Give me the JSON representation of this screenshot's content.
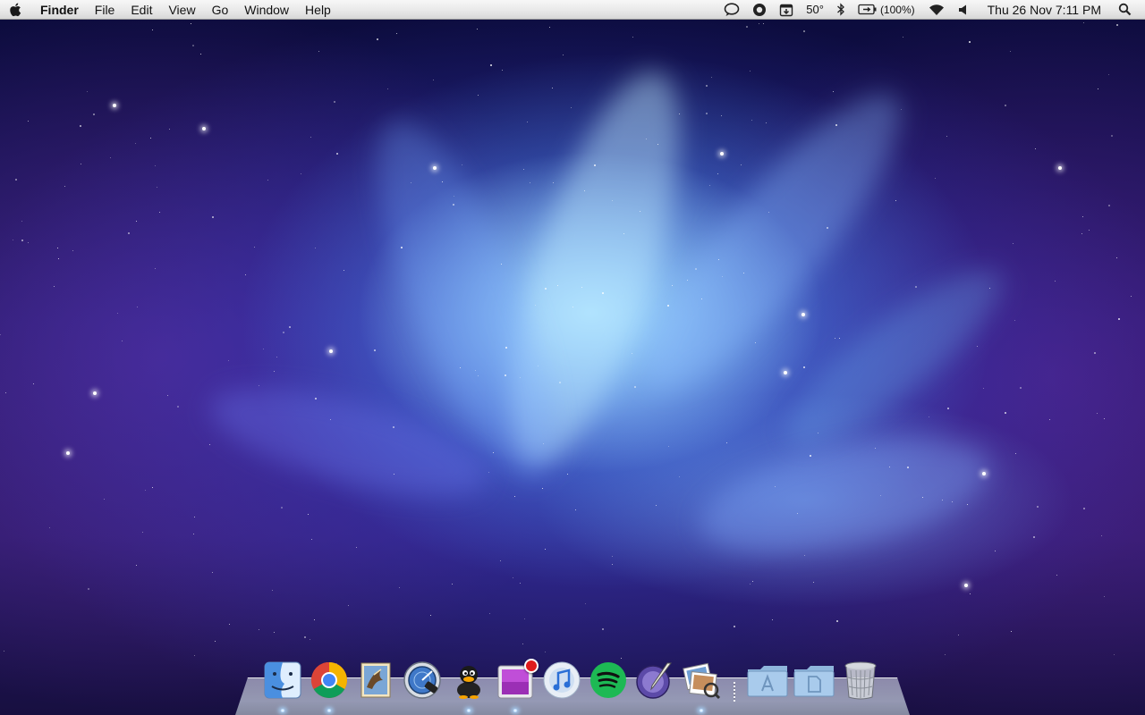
{
  "menubar": {
    "app_name": "Finder",
    "menus": [
      "File",
      "Edit",
      "View",
      "Go",
      "Window",
      "Help"
    ],
    "extras": {
      "temperature": "50°",
      "battery": "(100%)",
      "clock": "Thu 26 Nov  7:11 PM"
    }
  },
  "dock": {
    "apps": [
      {
        "name": "Finder",
        "icon": "finder-icon",
        "running": true
      },
      {
        "name": "Google Chrome",
        "icon": "chrome-icon",
        "running": true
      },
      {
        "name": "Mail",
        "icon": "mail-icon",
        "running": false
      },
      {
        "name": "Network Utility",
        "icon": "radar-icon",
        "running": false
      },
      {
        "name": "Adium",
        "icon": "duck-icon",
        "running": true
      },
      {
        "name": "App Store",
        "icon": "store-icon",
        "running": true,
        "badge": true
      },
      {
        "name": "iTunes",
        "icon": "itunes-icon",
        "running": false
      },
      {
        "name": "Spotify",
        "icon": "spotify-icon",
        "running": false
      },
      {
        "name": "Script Editor",
        "icon": "quill-icon",
        "running": false
      },
      {
        "name": "Preview",
        "icon": "preview-icon",
        "running": true
      }
    ],
    "stacks": [
      {
        "name": "Applications",
        "icon": "applications-folder-icon"
      },
      {
        "name": "Documents",
        "icon": "documents-folder-icon"
      }
    ],
    "trash": {
      "name": "Trash",
      "icon": "trash-icon"
    }
  },
  "colors": {
    "menubar_top": "#f7f7f7",
    "menubar_bottom": "#d7d7d7",
    "wallpaper_core": "#aee1ff",
    "wallpaper_mid": "#3c5ee0",
    "wallpaper_edge": "#1d1867",
    "spotify_green": "#1db954",
    "badge_red": "#e01b1b"
  }
}
